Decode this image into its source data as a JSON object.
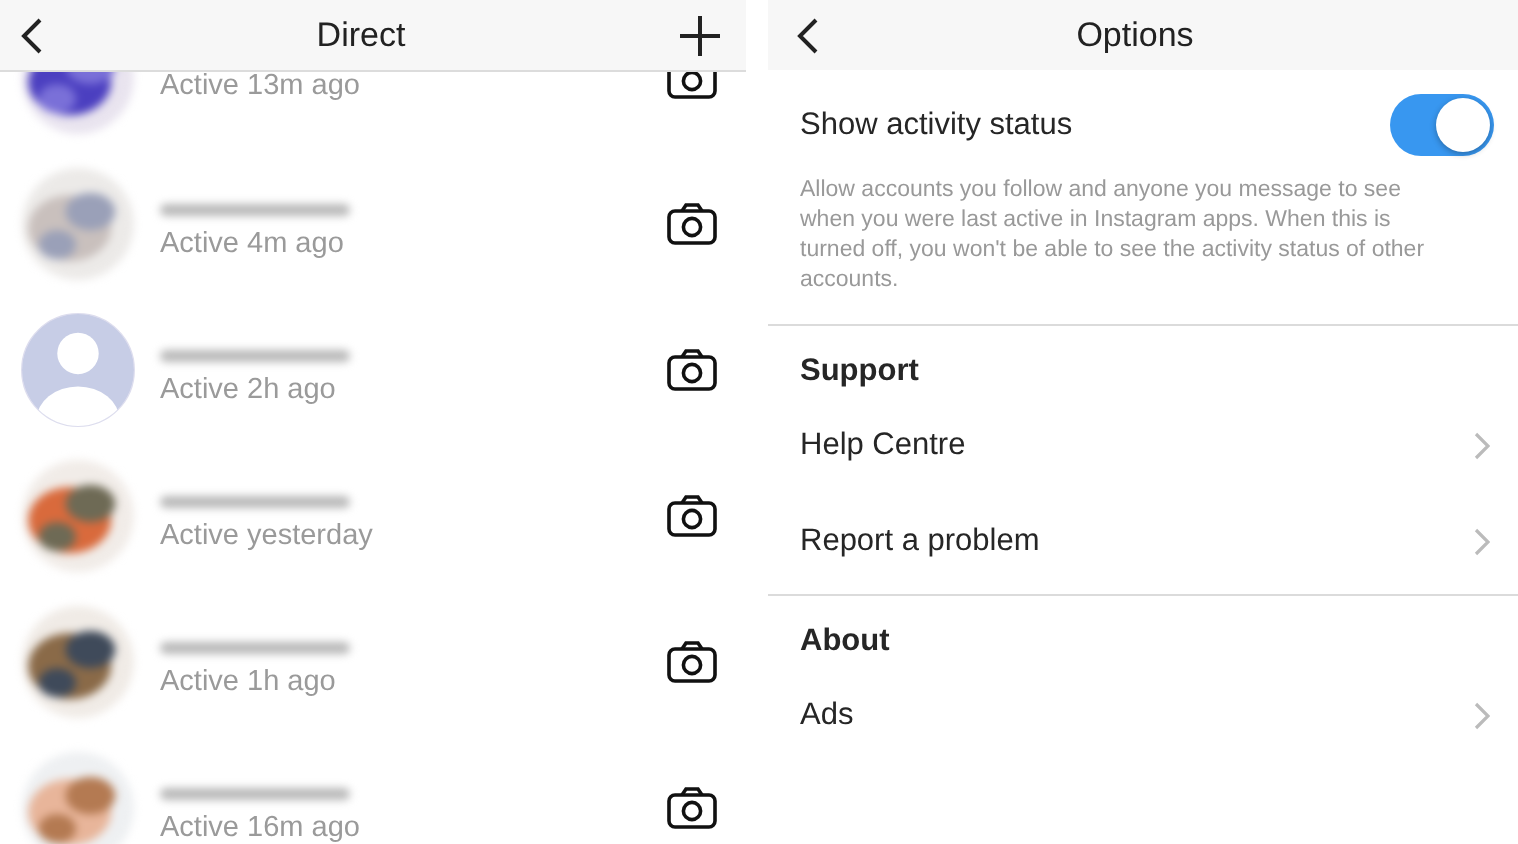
{
  "direct": {
    "title": "Direct",
    "threads": [
      {
        "status": "Active 13m ago"
      },
      {
        "status": "Active 4m ago"
      },
      {
        "status": "Active 2h ago",
        "kind": "placeholder"
      },
      {
        "status": "Active yesterday"
      },
      {
        "status": "Active 1h ago"
      },
      {
        "status": "Active 16m ago"
      }
    ]
  },
  "options": {
    "title": "Options",
    "activity": {
      "label": "Show activity status",
      "on": true,
      "description": "Allow accounts you follow and anyone you message to see when you were last active in Instagram apps. When this is turned off, you won't be able to see the activity status of other accounts."
    },
    "items": [
      {
        "kind": "header",
        "label": "Support"
      },
      {
        "kind": "link",
        "label": "Help Centre"
      },
      {
        "kind": "link",
        "label": "Report a problem"
      },
      {
        "kind": "header",
        "label": "About"
      },
      {
        "kind": "link",
        "label": "Ads"
      }
    ]
  }
}
